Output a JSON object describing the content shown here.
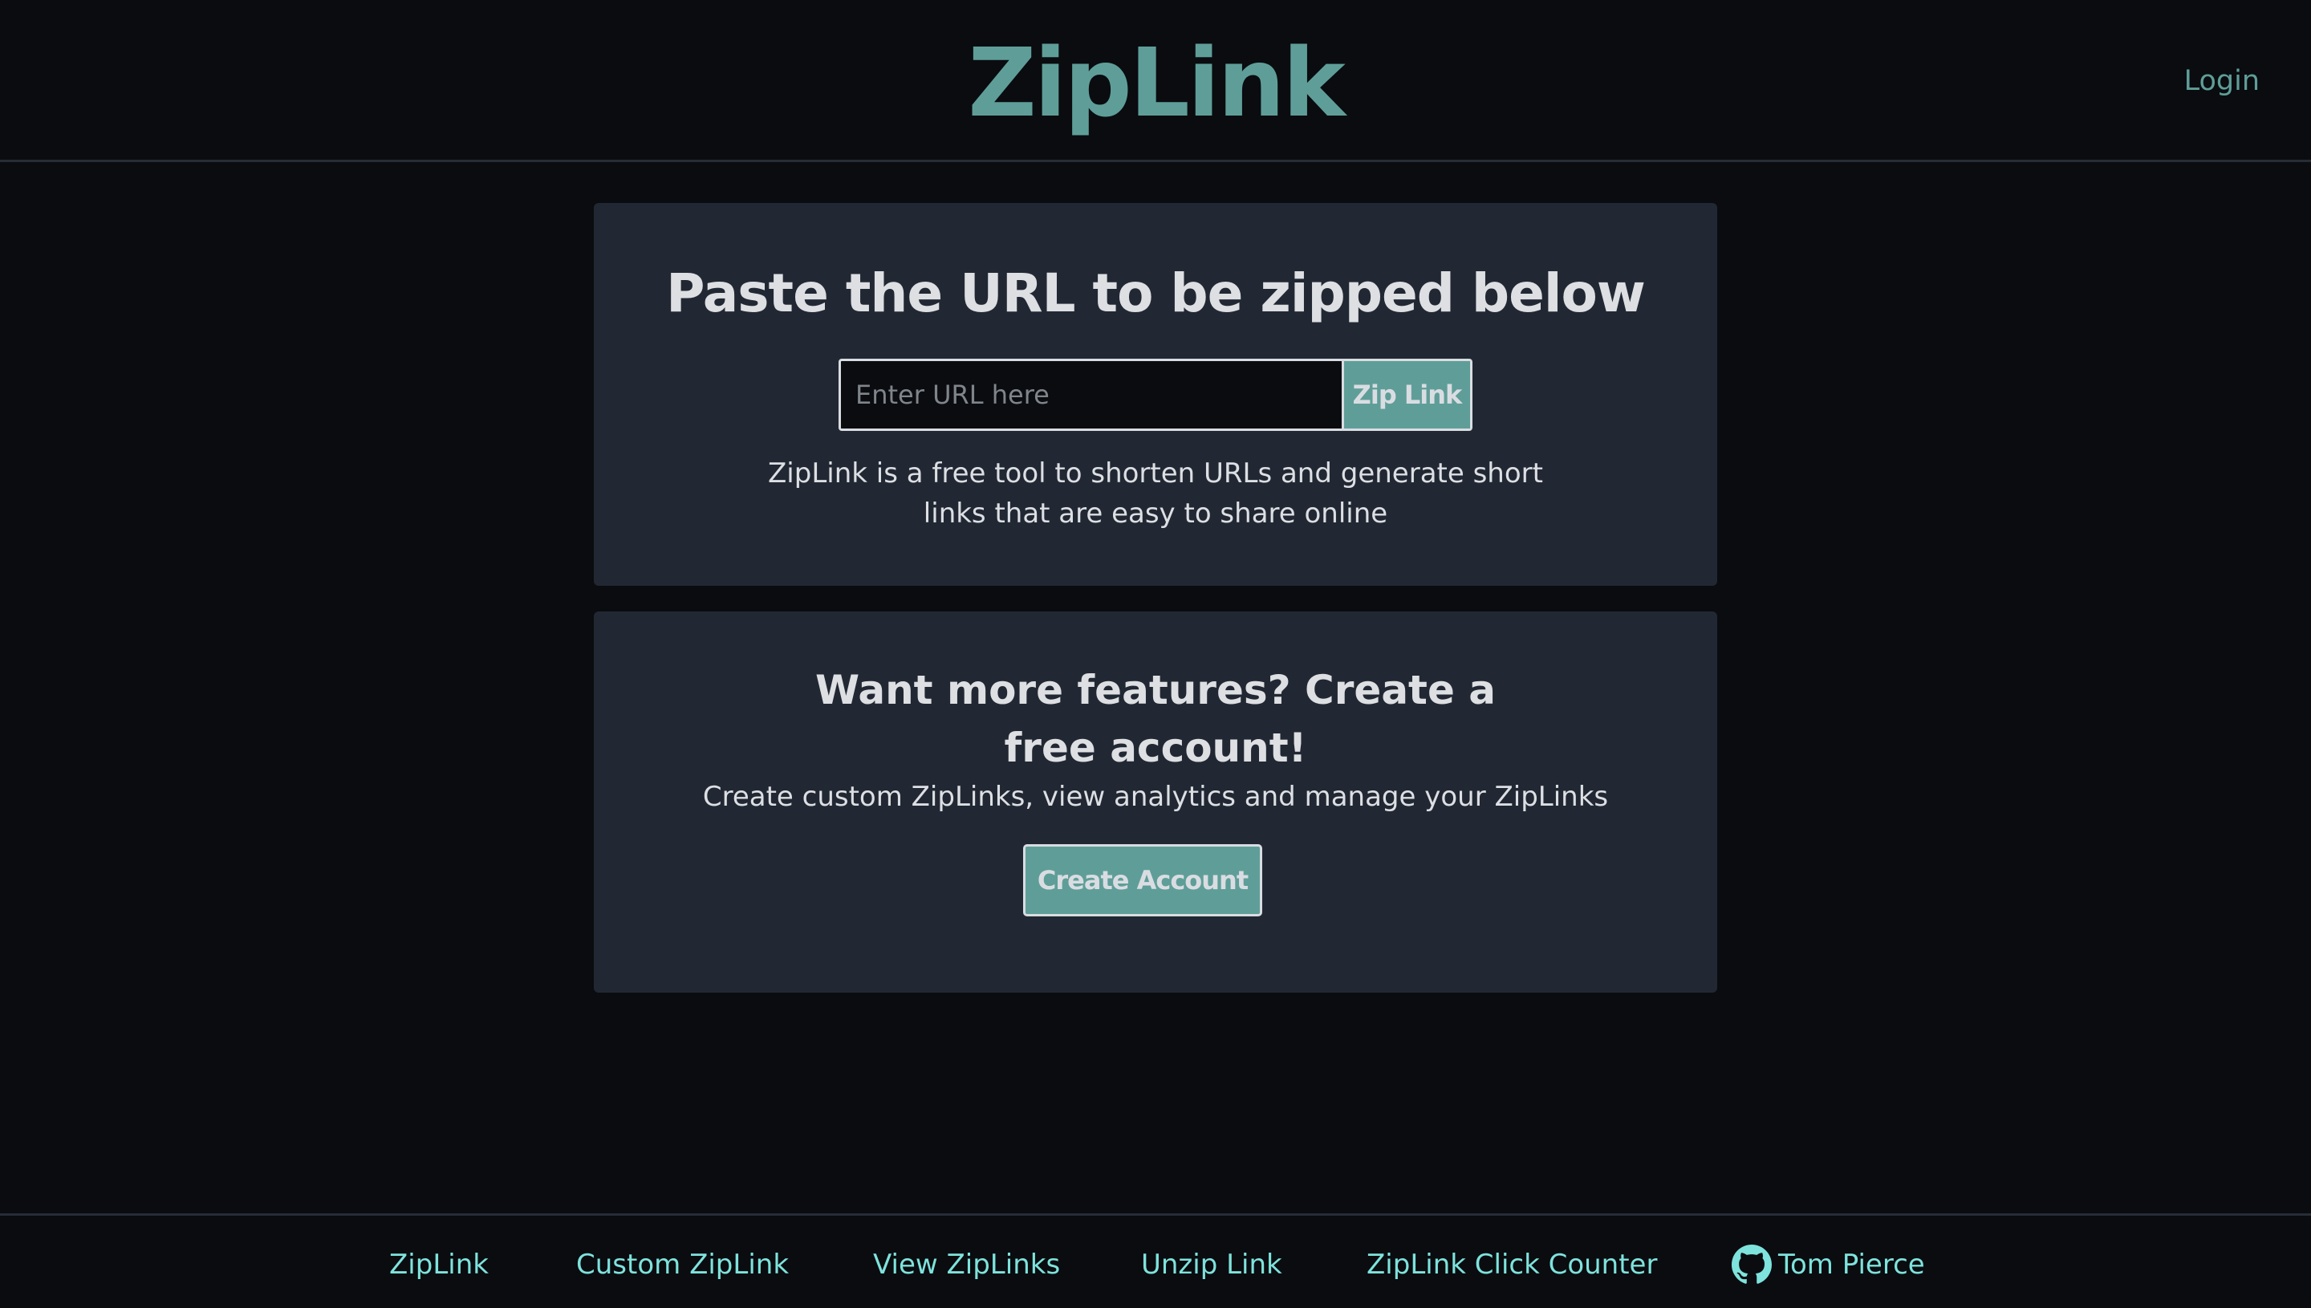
{
  "header": {
    "logo": "ZipLink",
    "login_label": "Login"
  },
  "hero": {
    "title": "Paste the URL to be zipped below",
    "input_placeholder": "Enter URL here",
    "input_value": "",
    "zip_button_label": "Zip Link",
    "description": "ZipLink is a free tool to shorten URLs and generate short links that are easy to share online"
  },
  "signup": {
    "title": "Want more features? Create a free account!",
    "description": "Create custom ZipLinks, view analytics and manage your ZipLinks",
    "button_label": "Create Account"
  },
  "footer": {
    "links": [
      {
        "label": "ZipLink"
      },
      {
        "label": "Custom ZipLink"
      },
      {
        "label": "View ZipLinks"
      },
      {
        "label": "Unzip Link"
      },
      {
        "label": "ZipLink Click Counter"
      },
      {
        "label": "Tom Pierce",
        "icon": "github-icon"
      }
    ]
  },
  "colors": {
    "background": "#0a0c10",
    "card": "#222833",
    "accent": "#5f9e98",
    "footer_link": "#7ee3dc",
    "text": "#dcdfe3"
  }
}
